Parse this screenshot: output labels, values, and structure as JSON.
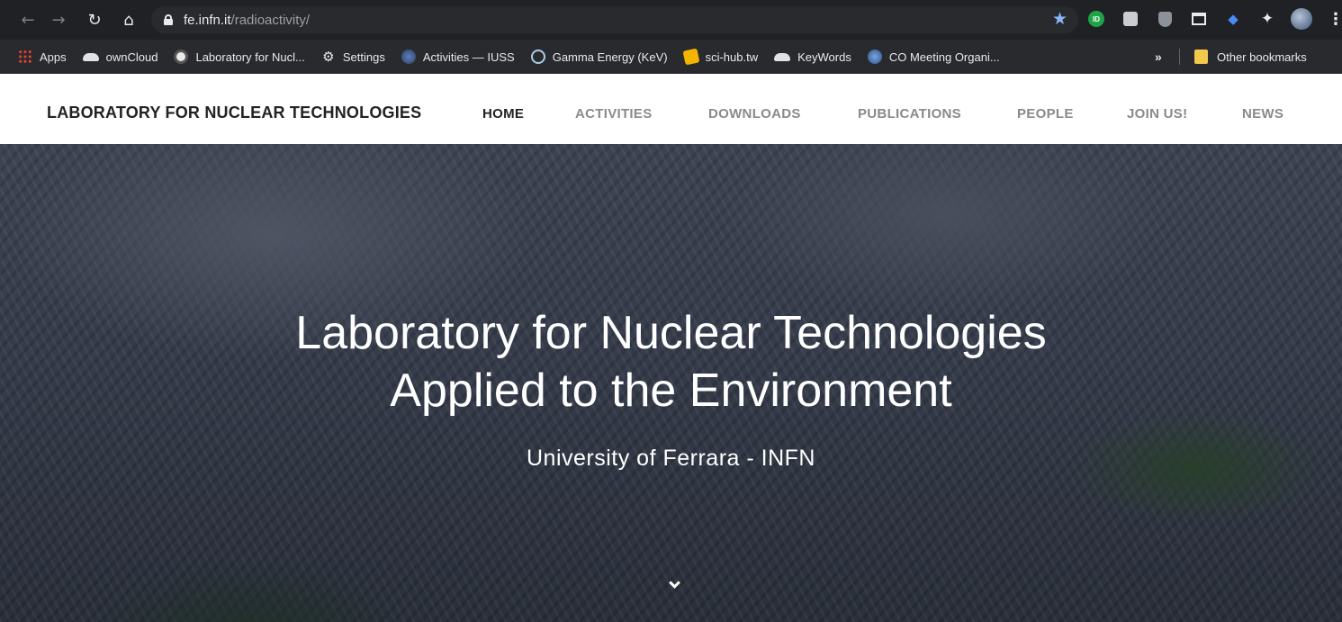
{
  "browser": {
    "url_host": "fe.infn.it",
    "url_path": "/radioactivity/"
  },
  "bookmarks": {
    "items": [
      {
        "label": "Apps",
        "icon": "apps-icon"
      },
      {
        "label": "ownCloud",
        "icon": "cloud-icon"
      },
      {
        "label": "Laboratory for Nucl...",
        "icon": "globe-icon"
      },
      {
        "label": "Settings",
        "icon": "gear-icon"
      },
      {
        "label": "Activities — IUSS",
        "icon": "iuss-icon"
      },
      {
        "label": "Gamma Energy (KeV)",
        "icon": "ring-icon"
      },
      {
        "label": "sci-hub.tw",
        "icon": "scihub-icon"
      },
      {
        "label": "KeyWords",
        "icon": "cloud-icon"
      },
      {
        "label": "CO Meeting Organi...",
        "icon": "co-icon"
      }
    ],
    "more": "»",
    "other": "Other bookmarks"
  },
  "site": {
    "brand": "LABORATORY FOR NUCLEAR TECHNOLOGIES",
    "nav": [
      "HOME",
      "ACTIVITIES",
      "DOWNLOADS",
      "PUBLICATIONS",
      "PEOPLE",
      "JOIN US!",
      "NEWS"
    ],
    "active_nav": "HOME"
  },
  "hero": {
    "title_line1": "Laboratory for Nuclear Technologies",
    "title_line2": "Applied to the Environment",
    "subtitle": "University of Ferrara - INFN"
  }
}
